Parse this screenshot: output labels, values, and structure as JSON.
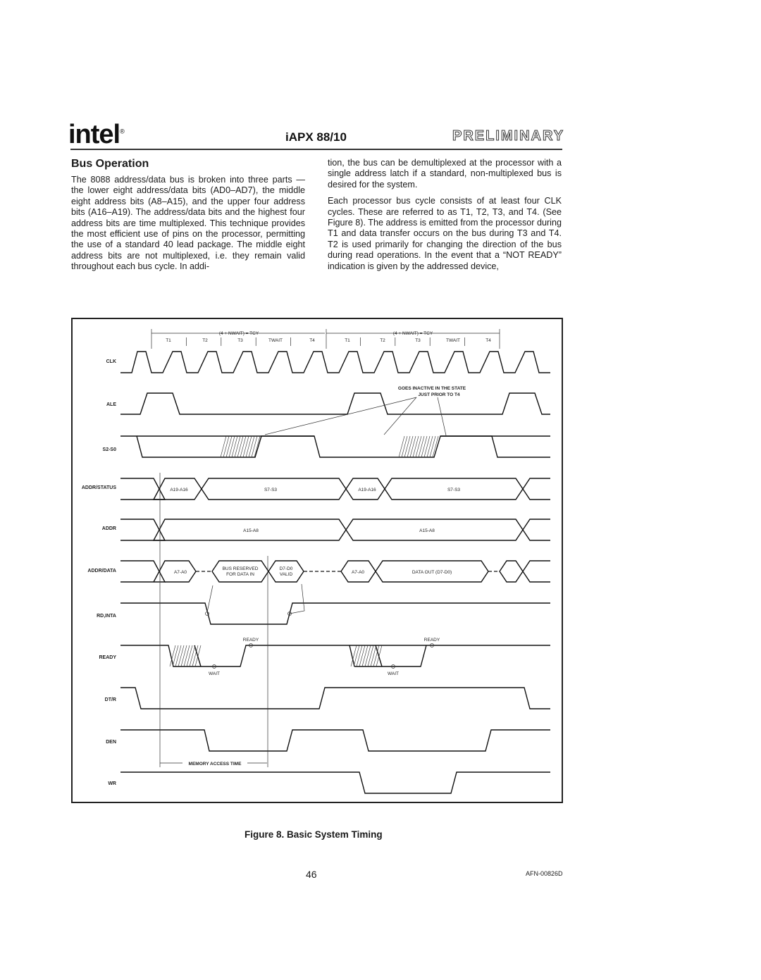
{
  "header": {
    "logo": "intel",
    "title": "iAPX 88/10",
    "stamp": "PRELIMINARY"
  },
  "section": {
    "heading": "Bus Operation",
    "left_paragraph": "The 8088 address/data bus is broken into three parts — the lower eight address/data bits (AD0–AD7), the middle eight address bits (A8–A15), and the upper four address bits (A16–A19). The address/data bits and the highest four address bits are time multiplexed. This technique provides the most efficient use of pins on the processor, permitting the use of a standard 40 lead package. The middle eight address bits are not multiplexed, i.e. they remain valid throughout each bus cycle. In addi-",
    "right_paragraph_1": "tion, the bus can be demultiplexed at the processor with a single address latch if a standard, non-multiplexed bus is desired for the system.",
    "right_paragraph_2": "Each processor bus cycle consists of at least four CLK cycles. These are referred to as T1, T2, T3, and T4. (See Figure 8). The address is emitted from the processor during T1 and data transfer occurs on the bus during T3 and T4. T2 is used primarily for changing the direction of the bus during read operations. In the event that a “NOT READY” indication is given by the addressed device,"
  },
  "figure": {
    "caption": "Figure 8. Basic System Timing",
    "cycle_label": "(4 + NWAIT) = TCY",
    "states": [
      "T1",
      "T2",
      "T3",
      "TWAIT",
      "T4",
      "T1",
      "T2",
      "T3",
      "TWAIT",
      "T4"
    ],
    "signals": [
      "CLK",
      "ALE",
      "S2-S0",
      "ADDR/STATUS",
      "ADDR",
      "ADDR/DATA",
      "RD,INTA",
      "READY",
      "DT/R",
      "DEN",
      "WR"
    ],
    "annotations": {
      "ale_note_line1": "GOES INACTIVE IN THE STATE",
      "ale_note_line2": "JUST PRIOR TO T4",
      "addr_status_high": "A19-A16",
      "addr_status_status": "S7-S3",
      "addr_mid": "A15-A8",
      "addr_data_low": "A7-A0",
      "bus_reserved_1": "BUS RESERVED",
      "bus_reserved_2": "FOR DATA IN",
      "data_valid_1": "D7-D0",
      "data_valid_2": "VALID",
      "data_out": "DATA OUT (D7-D0)",
      "ready": "READY",
      "wait": "WAIT",
      "memory_access": "MEMORY ACCESS TIME"
    }
  },
  "footer": {
    "page_number": "46",
    "doc_code": "AFN-00826D"
  }
}
